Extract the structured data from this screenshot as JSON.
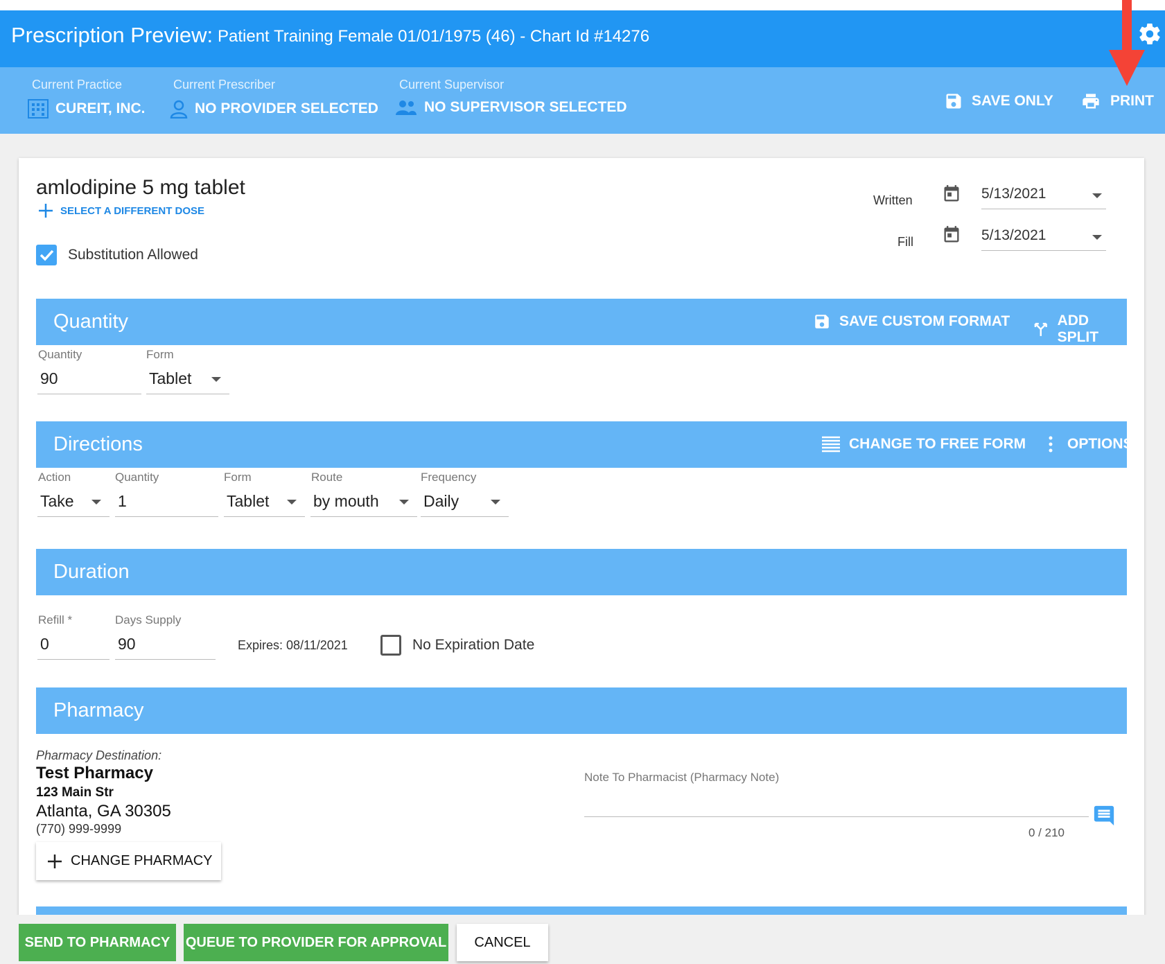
{
  "header": {
    "title": "Prescription Preview:",
    "patient": "Patient Training Female 01/01/1975 (46) - Chart Id #14276",
    "practice_label": "Current Practice",
    "practice_value": "CUREIT, INC.",
    "prescriber_label": "Current Prescriber",
    "prescriber_value": "NO PROVIDER SELECTED",
    "supervisor_label": "Current Supervisor",
    "supervisor_value": "NO SUPERVISOR SELECTED",
    "save_only": "SAVE ONLY",
    "print": "PRINT"
  },
  "drug": {
    "name": "amlodipine 5 mg tablet",
    "select_dose": "SELECT A DIFFERENT DOSE",
    "substitution": "Substitution Allowed",
    "substitution_checked": true
  },
  "dates": {
    "written_label": "Written",
    "written_value": "5/13/2021",
    "fill_label": "Fill",
    "fill_value": "5/13/2021"
  },
  "quantity": {
    "title": "Quantity",
    "save_custom": "SAVE CUSTOM FORMAT",
    "add_split": "ADD SPLIT",
    "qty_label": "Quantity",
    "qty_value": "90",
    "form_label": "Form",
    "form_value": "Tablet"
  },
  "directions": {
    "title": "Directions",
    "free_form": "CHANGE TO FREE FORM",
    "options": "OPTIONS",
    "action_label": "Action",
    "action_value": "Take",
    "qty_label": "Quantity",
    "qty_value": "1",
    "form_label": "Form",
    "form_value": "Tablet",
    "route_label": "Route",
    "route_value": "by mouth",
    "freq_label": "Frequency",
    "freq_value": "Daily"
  },
  "duration": {
    "title": "Duration",
    "refill_label": "Refill *",
    "refill_value": "0",
    "days_label": "Days Supply",
    "days_value": "90",
    "expires": "Expires: 08/11/2021",
    "no_expiration": "No Expiration Date",
    "no_expiration_checked": false
  },
  "pharmacy": {
    "title": "Pharmacy",
    "dest_label": "Pharmacy Destination:",
    "name": "Test Pharmacy",
    "address1": "123 Main Str",
    "address2": "Atlanta, GA 30305",
    "phone": "(770) 999-9999",
    "change": "CHANGE PHARMACY",
    "note_label": "Note To Pharmacist (Pharmacy Note)",
    "note_value": "",
    "note_count": "0 / 210"
  },
  "footer": {
    "send": "SEND TO PHARMACY",
    "queue": "QUEUE TO PROVIDER FOR APPROVAL",
    "cancel": "CANCEL"
  },
  "colors": {
    "primary": "#2196f3",
    "section": "#64b5f6",
    "green": "#4caf50",
    "annotation_arrow": "#f44336"
  }
}
